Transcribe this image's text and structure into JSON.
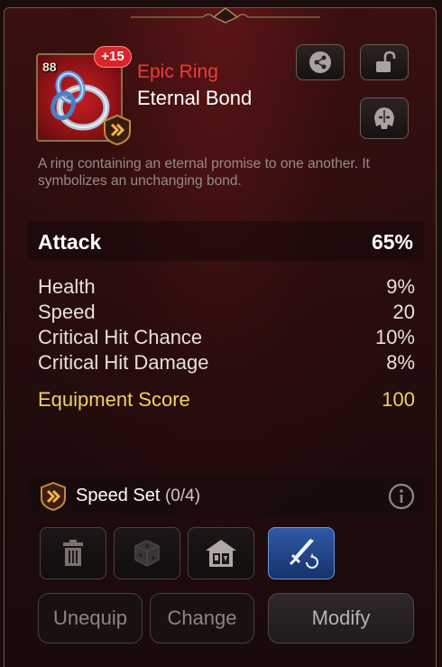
{
  "item": {
    "level": "88",
    "enhance": "+15",
    "rarity": "Epic Ring",
    "name": "Eternal Bond",
    "description": "A ring containing an eternal promise to one another. It symbolizes an unchanging bond."
  },
  "main_stat": {
    "label": "Attack",
    "value": "65%"
  },
  "sub_stats": [
    {
      "label": "Health",
      "value": "9%"
    },
    {
      "label": "Speed",
      "value": "20"
    },
    {
      "label": "Critical Hit Chance",
      "value": "10%"
    },
    {
      "label": "Critical Hit Damage",
      "value": "8%"
    }
  ],
  "score": {
    "label": "Equipment Score",
    "value": "100"
  },
  "set": {
    "name": "Speed Set",
    "count": "(0/4)"
  },
  "actions": {
    "unequip": "Unequip",
    "change": "Change",
    "modify": "Modify"
  },
  "icons": {
    "share": "share-icon",
    "lock": "unlock-icon",
    "hero": "helmet-icon",
    "delete": "trash-icon",
    "dice": "dice-icon",
    "shop": "shop-icon",
    "reforge": "sword-icon"
  },
  "colors": {
    "rarity": "#ef3b3b",
    "score": "#f3d15c",
    "active_tool": "#2f5aa6"
  }
}
